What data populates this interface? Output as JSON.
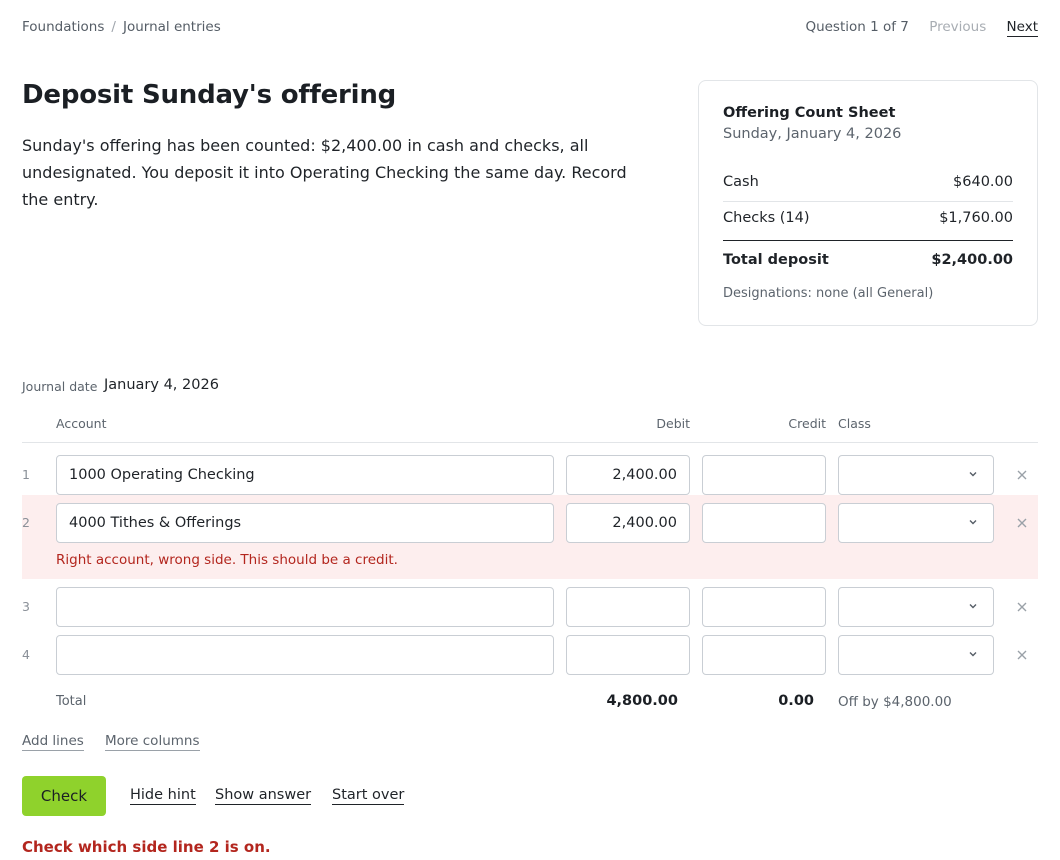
{
  "nav": {
    "breadcrumb": [
      "Foundations",
      "Journal entries"
    ],
    "breadcrumb_separator": "/",
    "question_counter": "Question 1 of 7",
    "previous_label": "Previous",
    "next_label": "Next"
  },
  "question": {
    "title": "Deposit Sunday's offering",
    "prompt": "Sunday's offering has been counted: $2,400.00 in cash and checks, all undesignated. You deposit it into Operating Checking the same day. Record the entry."
  },
  "count_sheet": {
    "title": "Offering Count Sheet",
    "date": "Sunday, January 4, 2026",
    "rows": [
      {
        "label": "Cash",
        "amount": "$640.00"
      },
      {
        "label": "Checks (14)",
        "amount": "$1,760.00"
      }
    ],
    "total_label": "Total deposit",
    "total_amount": "$2,400.00",
    "note": "Designations: none (all General)"
  },
  "journal": {
    "date_label": "Journal date",
    "date_value": "January 4, 2026",
    "headers": {
      "account": "Account",
      "debit": "Debit",
      "credit": "Credit",
      "class": "Class"
    },
    "lines": [
      {
        "number": "1",
        "account": "1000 Operating Checking",
        "debit": "2,400.00",
        "credit": "",
        "class": ""
      },
      {
        "number": "2",
        "account": "4000 Tithes & Offerings",
        "debit": "2,400.00",
        "credit": "",
        "class": "",
        "error": "Right account, wrong side. This should be a credit."
      },
      {
        "number": "3",
        "account": "",
        "debit": "",
        "credit": "",
        "class": ""
      },
      {
        "number": "4",
        "account": "",
        "debit": "",
        "credit": "",
        "class": ""
      }
    ],
    "total_label": "Total",
    "total_debit": "4,800.00",
    "total_credit": "0.00",
    "off_by": "Off by $4,800.00",
    "add_lines_label": "Add lines",
    "more_columns_label": "More columns"
  },
  "actions": {
    "check_label": "Check",
    "hide_hint_label": "Hide hint",
    "show_answer_label": "Show answer",
    "start_over_label": "Start over"
  },
  "hint": "Check which side line 2 is on.",
  "colors": {
    "accent_button": "#8fd22c",
    "error_text": "#b3261e",
    "error_background": "#fdeeee"
  },
  "icons": {
    "select": "chevron-down-icon",
    "remove_line": "close-icon"
  }
}
